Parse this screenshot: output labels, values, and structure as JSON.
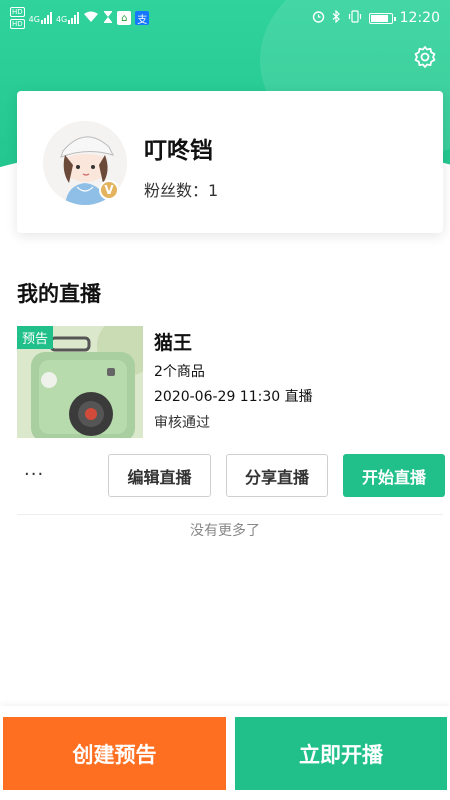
{
  "status_bar": {
    "sim1": "HD",
    "sim2": "HD",
    "net1": "4G",
    "net2": "4G",
    "time": "12:20",
    "battery_level": 0.85,
    "app_icons": [
      "home-app-icon",
      "alipay-icon"
    ]
  },
  "header": {
    "settings_icon": "gear-icon"
  },
  "profile": {
    "nickname": "叮咚铛",
    "fans_label": "粉丝数：",
    "fans_count": "1",
    "verified_badge": "V"
  },
  "section": {
    "title": "我的直播"
  },
  "live_item": {
    "tag": "预告",
    "name": "猫王",
    "product_count": "2个商品",
    "datetime": "2020-06-29 11:30 直播",
    "review_status": "审核通过",
    "more_label": "···",
    "edit_label": "编辑直播",
    "share_label": "分享直播",
    "start_label": "开始直播"
  },
  "list_footer": {
    "no_more": "没有更多了"
  },
  "bottom": {
    "create_label": "创建预告",
    "golive_label": "立即开播"
  },
  "colors": {
    "brand_green": "#21c08b",
    "orange": "#ff6f22"
  }
}
